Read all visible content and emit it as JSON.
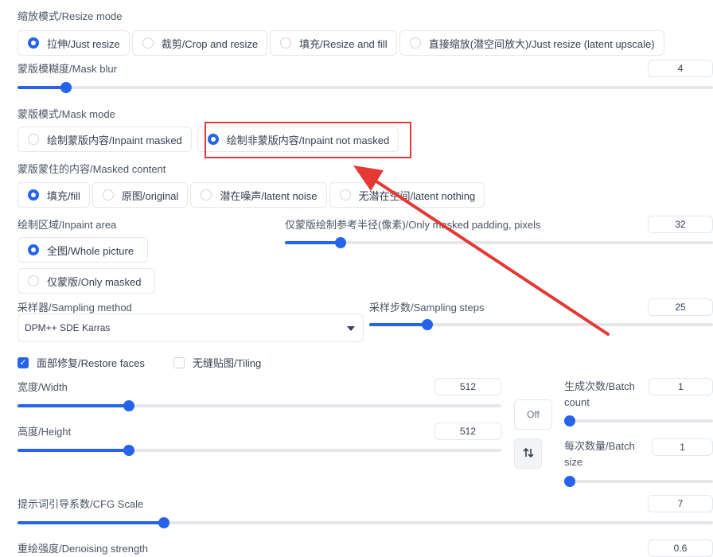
{
  "resize": {
    "label": "缩放模式/Resize mode",
    "options": [
      "拉伸/Just resize",
      "裁剪/Crop and resize",
      "填充/Resize and fill",
      "直接缩放(潜空间放大)/Just resize (latent upscale)"
    ],
    "selected": 0
  },
  "mask_blur": {
    "label": "蒙版模糊度/Mask blur",
    "value": "4",
    "fraction": 0.07
  },
  "mask_mode": {
    "label": "蒙版模式/Mask mode",
    "options": [
      "绘制蒙版内容/Inpaint masked",
      "绘制非蒙版内容/Inpaint not masked"
    ],
    "selected": 1
  },
  "masked_content": {
    "label": "蒙版蒙住的内容/Masked content",
    "options": [
      "填充/fill",
      "原图/original",
      "潜在噪声/latent noise",
      "无潜在空间/latent nothing"
    ],
    "selected": 0
  },
  "inpaint_area": {
    "label": "绘制区域/Inpaint area",
    "options": [
      "全图/Whole picture",
      "仅蒙版/Only masked"
    ],
    "selected": 0
  },
  "padding": {
    "label": "仅蒙版绘制参考半径(像素)/Only masked padding, pixels",
    "value": "32",
    "fraction": 0.13
  },
  "sampler": {
    "label": "采样器/Sampling method",
    "value": "DPM++ SDE Karras"
  },
  "steps": {
    "label": "采样步数/Sampling steps",
    "value": "25",
    "fraction": 0.17
  },
  "restore_faces": {
    "label": "面部修复/Restore faces",
    "checked": true
  },
  "tiling": {
    "label": "无缝贴图/Tiling",
    "checked": false
  },
  "width": {
    "label": "宽度/Width",
    "value": "512",
    "fraction": 0.23
  },
  "height": {
    "label": "高度/Height",
    "value": "512",
    "fraction": 0.23
  },
  "off_button": "Off",
  "batch_count": {
    "label_1": "生成次数/Batch",
    "label_2": "count",
    "value": "1",
    "fraction": 0.0
  },
  "batch_size": {
    "label_1": "每次数量/Batch",
    "label_2": "size",
    "value": "1",
    "fraction": 0.0
  },
  "cfg": {
    "label": "提示词引导系数/CFG Scale",
    "value": "7",
    "fraction": 0.21
  },
  "denoise": {
    "label": "重绘强度/Denoising strength",
    "value": "0.6"
  },
  "icons": {
    "swap": "swap-arrows-icon",
    "dropdown": "caret-down-icon",
    "check": "checkmark-icon"
  },
  "colors": {
    "accent": "#2563eb",
    "annotation": "#e53935"
  }
}
